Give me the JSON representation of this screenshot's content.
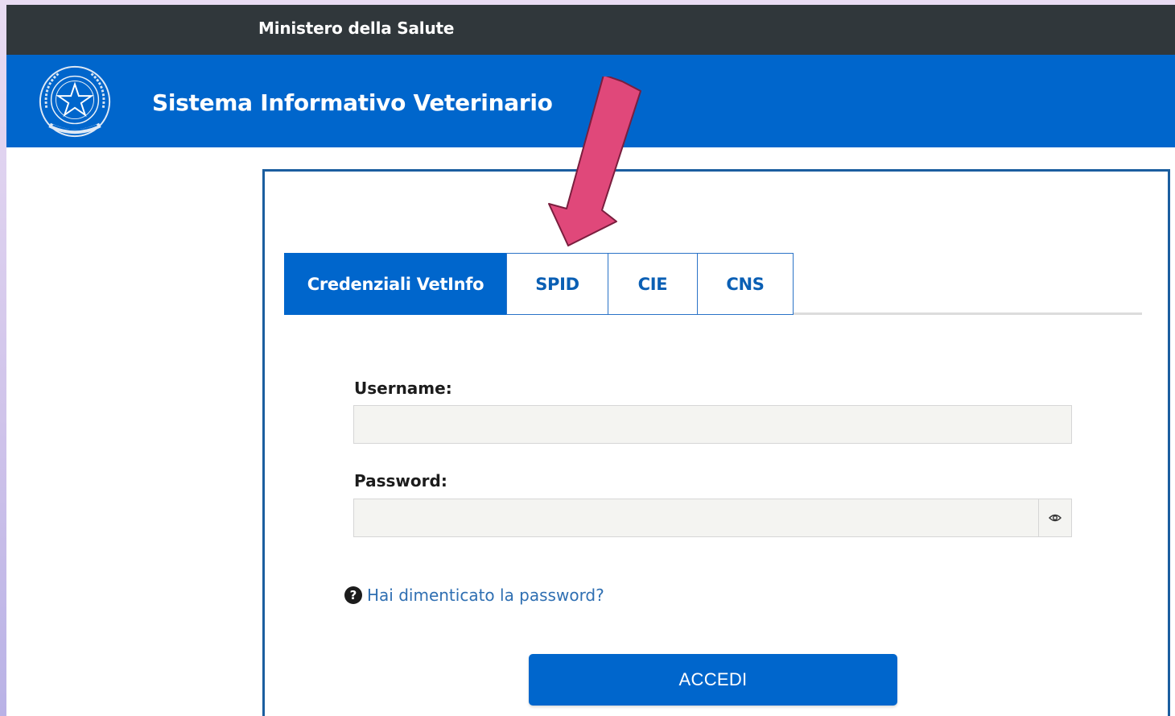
{
  "topbar": {
    "ministry": "Ministero della Salute"
  },
  "header": {
    "app_title": "Sistema Informativo Veterinario",
    "emblem_icon": "italian-republic-emblem"
  },
  "tabs": [
    {
      "label": "Credenziali VetInfo",
      "active": true
    },
    {
      "label": "SPID",
      "active": false
    },
    {
      "label": "CIE",
      "active": false
    },
    {
      "label": "CNS",
      "active": false
    }
  ],
  "form": {
    "username_label": "Username:",
    "username_value": "",
    "password_label": "Password:",
    "password_value": "",
    "show_password_icon": "eye-icon",
    "forgot_icon": "question-circle-icon",
    "forgot_password": "Hai dimenticato la password?",
    "submit_label": "ACCEDI"
  },
  "annotation": {
    "arrow_color": "#e0487a",
    "points_to": "SPID"
  },
  "colors": {
    "brand_blue": "#0066cc",
    "topbar": "#30373b",
    "card_border": "#1b5e9f"
  }
}
